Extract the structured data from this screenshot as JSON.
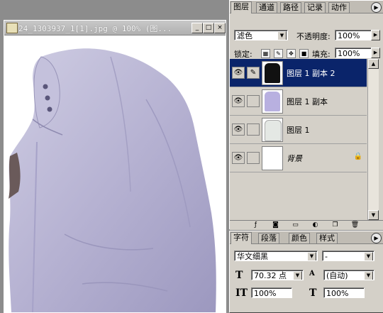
{
  "document": {
    "title": "24_1303937_1[1].jpg @ 100% (图...",
    "buttons": {
      "minimize": "_",
      "maximize": "□",
      "close": "×"
    }
  },
  "layers_panel": {
    "tabs": [
      "图层",
      "通道",
      "路径",
      "记录",
      "动作"
    ],
    "blend_mode": "滤色",
    "opacity_label": "不透明度:",
    "opacity_value": "100%",
    "lock_label": "锁定:",
    "fill_label": "填充:",
    "fill_value": "100%",
    "layers": [
      {
        "name": "图层 1 副本 2",
        "selected": true,
        "linked_brush": true
      },
      {
        "name": "图层 1 副本",
        "selected": false,
        "linked_brush": false
      },
      {
        "name": "图层 1",
        "selected": false,
        "linked_brush": false
      },
      {
        "name": "背景",
        "selected": false,
        "linked_brush": false,
        "locked": true
      }
    ],
    "icons": [
      "eye-icon",
      "brush-icon",
      "lock-icon",
      "link-icon",
      "fx-icon",
      "mask-icon",
      "folder-icon",
      "adjustment-icon",
      "new-layer-icon",
      "trash-icon"
    ]
  },
  "char_panel": {
    "tabs": [
      "字符",
      "段落",
      "颜色",
      "样式"
    ],
    "font_family": "华文细黑",
    "font_style": "-",
    "font_size": "70.32 点",
    "leading": "(自动)",
    "vertical_scale": "100%",
    "horizontal_scale": "100%"
  },
  "colors": {
    "panel_bg": "#d4d0c8",
    "selection": "#0a246a",
    "workspace": "#8c8c8c",
    "jacket": "#b8b4d4"
  }
}
